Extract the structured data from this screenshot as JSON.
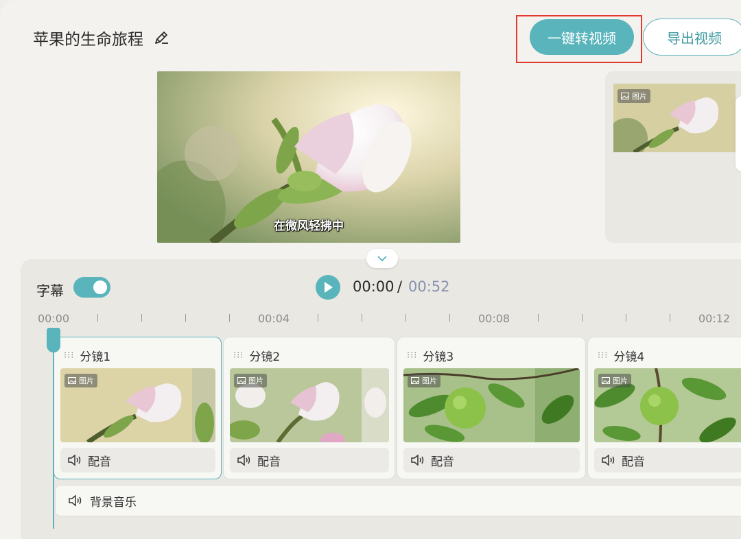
{
  "header": {
    "title": "苹果的生命旅程",
    "convert_label": "一键转视频",
    "export_label": "导出视频"
  },
  "preview": {
    "caption": "在微风轻拂中",
    "side_badge": "图片"
  },
  "timeline": {
    "subtitle_label": "字幕",
    "subtitle_enabled": true,
    "current_time": "00:00",
    "separator": "/",
    "total_time": "00:52",
    "ruler": [
      "00:00",
      "00:04",
      "00:08",
      "00:12"
    ],
    "clips": [
      {
        "label": "分镜1",
        "badge": "图片",
        "dub": "配音"
      },
      {
        "label": "分镜2",
        "badge": "图片",
        "dub": "配音"
      },
      {
        "label": "分镜3",
        "badge": "图片",
        "dub": "配音"
      },
      {
        "label": "分镜4",
        "badge": "图片",
        "dub": "配音"
      }
    ],
    "bgm_label": "背景音乐"
  },
  "colors": {
    "accent": "#59b4bb",
    "highlight": "#e23a2e"
  }
}
